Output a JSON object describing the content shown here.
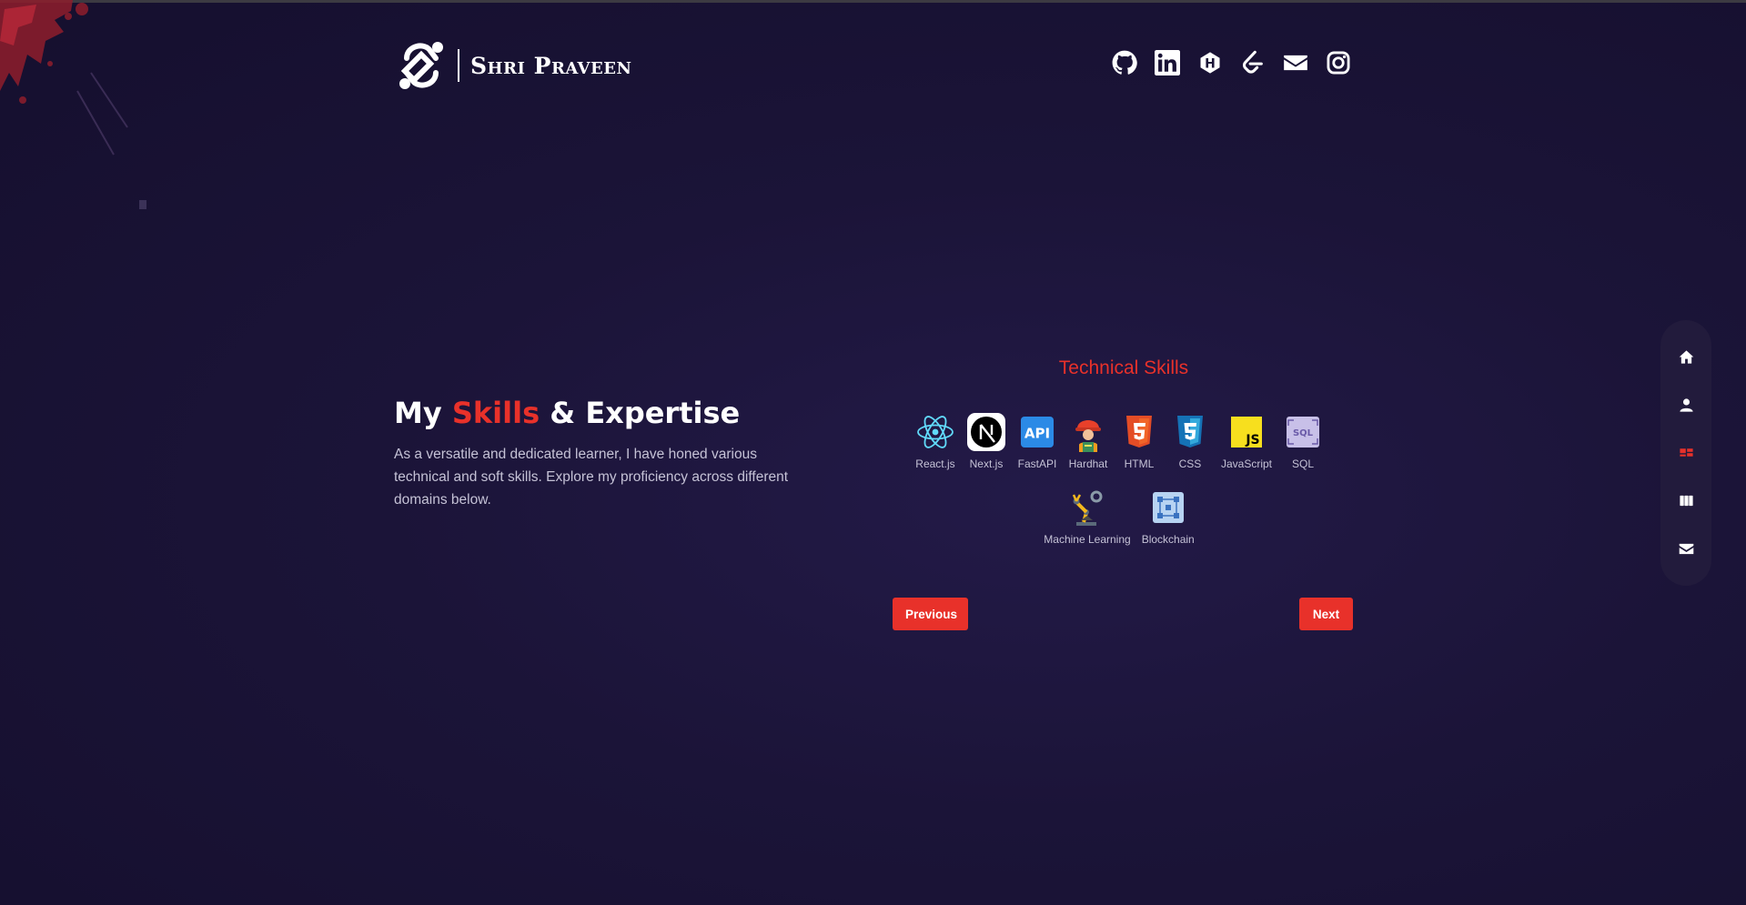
{
  "brand": {
    "name": "Shri Praveen"
  },
  "socials": [
    {
      "icon": "github-icon"
    },
    {
      "icon": "linkedin-icon"
    },
    {
      "icon": "hashnode-icon"
    },
    {
      "icon": "leetcode-icon"
    },
    {
      "icon": "mail-icon"
    },
    {
      "icon": "instagram-icon"
    }
  ],
  "hero": {
    "heading_prefix": "My",
    "heading_accent": "Skills",
    "heading_suffix": "& Expertise",
    "description": "As a versatile and dedicated learner, I have honed various technical and soft skills. Explore my proficiency across different domains below."
  },
  "skills": {
    "title": "Technical Skills",
    "items": [
      {
        "label": "React.js",
        "icon": "react-icon"
      },
      {
        "label": "Next.js",
        "icon": "nextjs-icon"
      },
      {
        "label": "FastAPI",
        "icon": "fastapi-icon"
      },
      {
        "label": "Hardhat",
        "icon": "hardhat-icon"
      },
      {
        "label": "HTML",
        "icon": "html5-icon"
      },
      {
        "label": "CSS",
        "icon": "css3-icon"
      },
      {
        "label": "JavaScript",
        "icon": "javascript-icon"
      },
      {
        "label": "SQL",
        "icon": "sql-icon"
      },
      {
        "label": "Machine Learning",
        "icon": "robot-arm-icon"
      },
      {
        "label": "Blockchain",
        "icon": "blockchain-icon"
      }
    ],
    "prev_label": "Previous",
    "next_label": "Next"
  },
  "sidenav": [
    {
      "icon": "home-icon"
    },
    {
      "icon": "user-icon"
    },
    {
      "icon": "skills-icon",
      "active": true
    },
    {
      "icon": "projects-icon"
    },
    {
      "icon": "mail-icon"
    }
  ],
  "colors": {
    "accent": "#e8312a",
    "background": "#1b1438",
    "nav_bg": "#221b3c",
    "text_muted": "#c5c2d6"
  }
}
